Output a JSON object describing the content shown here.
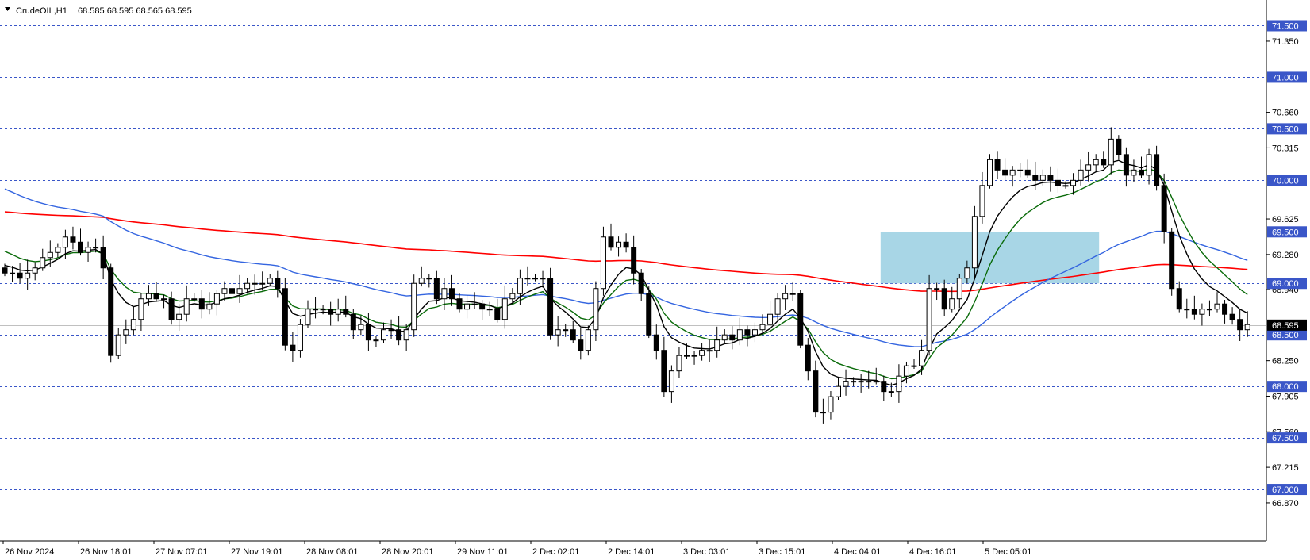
{
  "header": {
    "symbol": "CrudeOIL,H1",
    "ohlc": "68.585 68.595 68.565 68.595",
    "menu_icon": "triangle-down-icon"
  },
  "colors": {
    "background": "#ffffff",
    "level_line": "#3a56c8",
    "level_box_bg": "#3a56c8",
    "level_box_text": "#ffffff",
    "current_price_bg": "#000000",
    "current_price_text": "#ffffff",
    "candle_bull_body": "#ffffff",
    "candle_bear_body": "#000000",
    "candle_outline": "#000000",
    "ma_fast": "#000000",
    "ma_green": "#0a6b0a",
    "ma_blue": "#3465e0",
    "ma_red": "#ff0000",
    "zone_fill": "#a8d6e6"
  },
  "price_axis": {
    "range": [
      66.5,
      71.75
    ],
    "labels": [
      "71.350",
      "70.660",
      "70.315",
      "69.625",
      "69.280",
      "68.940",
      "68.250",
      "67.905",
      "67.560",
      "67.215",
      "66.870"
    ],
    "level_boxes": [
      "71.500",
      "71.000",
      "70.500",
      "70.000",
      "69.500",
      "69.000",
      "68.500",
      "68.000",
      "67.500",
      "67.000"
    ],
    "current_price": "68.595"
  },
  "time_axis": {
    "labels": [
      "26 Nov 2024",
      "26 Nov 18:01",
      "27 Nov 07:01",
      "27 Nov 19:01",
      "28 Nov 08:01",
      "28 Nov 20:01",
      "29 Nov 11:01",
      "2 Dec 02:01",
      "2 Dec 14:01",
      "3 Dec 03:01",
      "3 Dec 15:01",
      "4 Dec 04:01",
      "4 Dec 16:01",
      "5 Dec 05:01"
    ]
  },
  "zone": {
    "price_top": 69.5,
    "price_bottom": 69.0,
    "start_bar": 116,
    "end_bar": 144
  },
  "chart_data": {
    "type": "candlestick",
    "title": "CrudeOIL,H1",
    "ylim": [
      66.5,
      71.75
    ],
    "grid": "horizontal dashed at round levels",
    "closes": [
      69.1,
      69.1,
      69.05,
      69.1,
      69.15,
      69.25,
      69.3,
      69.35,
      69.45,
      69.4,
      69.3,
      69.35,
      69.35,
      69.15,
      68.3,
      68.5,
      68.55,
      68.65,
      68.85,
      68.9,
      68.85,
      68.85,
      68.65,
      68.7,
      68.85,
      68.85,
      68.75,
      68.8,
      68.9,
      68.95,
      68.9,
      68.95,
      69.0,
      69.0,
      69.0,
      69.05,
      68.95,
      68.4,
      68.35,
      68.6,
      68.75,
      68.75,
      68.75,
      68.7,
      68.75,
      68.7,
      68.55,
      68.6,
      68.45,
      68.45,
      68.55,
      68.55,
      68.45,
      68.55,
      69.0,
      69.05,
      69.05,
      68.85,
      68.95,
      68.85,
      68.75,
      68.8,
      68.8,
      68.75,
      68.75,
      68.65,
      68.85,
      68.9,
      69.05,
      69.05,
      69.05,
      69.05,
      68.5,
      68.55,
      68.55,
      68.45,
      68.35,
      68.55,
      68.95,
      69.45,
      69.35,
      69.4,
      69.35,
      69.1,
      68.9,
      68.5,
      68.35,
      67.95,
      68.15,
      68.3,
      68.3,
      68.3,
      68.35,
      68.35,
      68.45,
      68.5,
      68.45,
      68.55,
      68.5,
      68.55,
      68.6,
      68.7,
      68.85,
      68.9,
      68.9,
      68.4,
      68.15,
      67.75,
      67.75,
      67.9,
      68.0,
      68.05,
      68.05,
      68.05,
      68.05,
      68.05,
      67.95,
      67.95,
      68.1,
      68.2,
      68.2,
      68.35,
      68.95,
      68.95,
      68.75,
      68.85,
      69.05,
      69.15,
      69.65,
      69.95,
      70.2,
      70.1,
      70.05,
      70.1,
      70.1,
      70.05,
      70.0,
      70.05,
      70.0,
      69.95,
      69.95,
      70.0,
      70.1,
      70.15,
      70.2,
      70.15,
      70.4,
      70.25,
      70.05,
      70.1,
      70.05,
      70.25,
      69.95,
      69.5,
      68.95,
      68.75,
      68.75,
      68.7,
      68.75,
      68.75,
      68.8,
      68.7,
      68.65,
      68.55,
      68.6
    ]
  }
}
